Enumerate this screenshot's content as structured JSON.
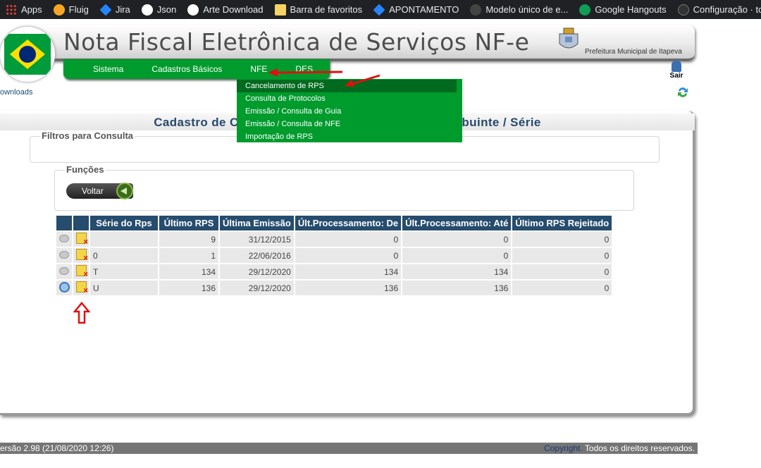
{
  "bookmarks": [
    {
      "label": "Apps",
      "icon": "apps-grid-icon"
    },
    {
      "label": "Fluig",
      "icon": "fluig-icon"
    },
    {
      "label": "Jira",
      "icon": "jira-icon"
    },
    {
      "label": "Json",
      "icon": "globe-icon"
    },
    {
      "label": "Arte Download",
      "icon": "globe-icon"
    },
    {
      "label": "Barra de favoritos",
      "icon": "folder-icon"
    },
    {
      "label": "APONTAMENTO",
      "icon": "jira-icon"
    },
    {
      "label": "Modelo único de e...",
      "icon": "page-icon"
    },
    {
      "label": "Google Hangouts",
      "icon": "hangouts-icon"
    },
    {
      "label": "Configuração · totv...",
      "icon": "github-icon"
    }
  ],
  "header": {
    "title": "Nota Fiscal Eletrônica de Serviços NF-e",
    "city": "Prefeitura Municipal de Itapeva",
    "logout_label": "Sair"
  },
  "menu": {
    "items": [
      "Sistema",
      "Cadastros Básicos",
      "NFE",
      "DES"
    ]
  },
  "dropdown": {
    "items": [
      "Cancelamento de RPS",
      "Consulta de Protocolos",
      "Emissão / Consulta de Guia",
      "Emissão / Consulta de NFE",
      "Importação de RPS"
    ]
  },
  "breadcrumb": "ownloads",
  "panel": {
    "title_left": "Cadastro de Con",
    "title_right": "ibuinte / Série",
    "filters_legend": "Filtros para Consulta",
    "functions_legend": "Funções",
    "back_label": "Voltar"
  },
  "table": {
    "headers": [
      "Série do Rps",
      "Último RPS",
      "Última Emissão",
      "Últ.Processamento: De",
      "Últ.Processamento: Até",
      "Último RPS Rejeitado"
    ],
    "rows": [
      {
        "serie": "",
        "ultimo_rps": "9",
        "emissao": "31/12/2015",
        "proc_de": "0",
        "proc_ate": "0",
        "rejeitado": "0",
        "view": "view-icon"
      },
      {
        "serie": "0",
        "ultimo_rps": "1",
        "emissao": "22/06/2016",
        "proc_de": "0",
        "proc_ate": "0",
        "rejeitado": "0",
        "view": "view-icon"
      },
      {
        "serie": "T",
        "ultimo_rps": "134",
        "emissao": "29/12/2020",
        "proc_de": "134",
        "proc_ate": "134",
        "rejeitado": "0",
        "view": "view-icon"
      },
      {
        "serie": "U",
        "ultimo_rps": "136",
        "emissao": "29/12/2020",
        "proc_de": "136",
        "proc_ate": "136",
        "rejeitado": "0",
        "view": "search-icon"
      }
    ]
  },
  "footer": {
    "version": "ersão 2.98 (21/08/2020 12:26)",
    "copyright_link": "Copyright.",
    "copyright_text": " Todos os direitos reservados."
  },
  "colors": {
    "menu_green": "#009b2d",
    "table_header": "#264c6e",
    "annotation_red": "#e01010"
  }
}
